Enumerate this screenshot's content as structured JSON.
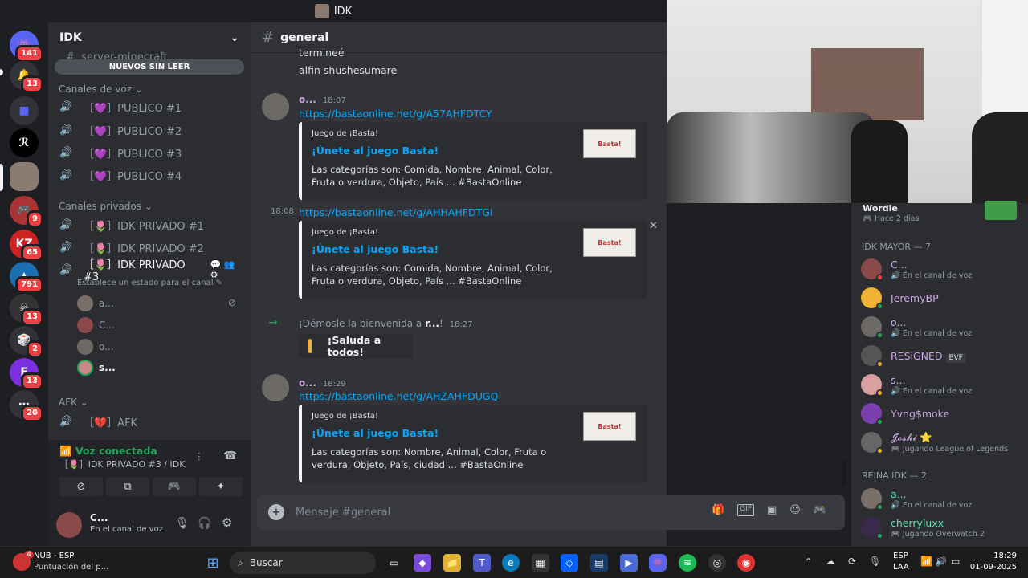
{
  "window": {
    "title": "IDK"
  },
  "rail": {
    "badges": [
      "141",
      "13",
      "9",
      "65",
      "791",
      "13",
      "2",
      "13",
      "20"
    ]
  },
  "server": {
    "name": "IDK"
  },
  "sidebar": {
    "faded_channel": "server-minecraft",
    "new_unread": "NUEVOS SIN LEER",
    "voice_category": "Canales de voz",
    "voice_channels": [
      "［💜］PUBLICO #1",
      "［💜］PUBLICO #2",
      "［💜］PUBLICO #3",
      "［💜］PUBLICO #4"
    ],
    "private_category": "Canales privados",
    "private_channels": [
      "［🌷］IDK PRIVADO #1",
      "［🌷］IDK PRIVADO #2",
      "［🌷］IDK PRIVADO #3"
    ],
    "status_hint": "Establece un estado para el canal",
    "voice_users": [
      "a...",
      "C...",
      "o...",
      "s..."
    ],
    "afk_category": "AFK",
    "afk_channel": "［💔］AFK"
  },
  "voice_panel": {
    "status": "Voz conectada",
    "channel": "［🌷］IDK PRIVADO #3 / IDK"
  },
  "user_panel": {
    "name": "C...",
    "status": "En el canal de voz"
  },
  "chat": {
    "channel": "general",
    "top_text_1": "termineé",
    "top_text_2": "alfin shushesumare",
    "msg1": {
      "author": "o...",
      "time": "18:07",
      "link": "https://bastaonline.net/g/A57AHFDTCY"
    },
    "embed_provider": "Juego de ¡Basta!",
    "embed_title": "¡Únete al juego Basta!",
    "embed1_desc": "Las categorías son: Comida, Nombre, Animal, Color, Fruta o verdura, Objeto, País ... #BastaOnline",
    "msg2": {
      "time": "18:08",
      "link": "https://bastaonline.net/g/AHHAHFDTGI"
    },
    "embed2_desc": "Las categorías son: Comida, Nombre, Animal, Color, Fruta o verdura, Objeto, País ... #BastaOnline",
    "welcome": {
      "prefix": "¡Démosle la bienvenida a ",
      "name": "r...",
      "suffix": "!",
      "time": "18:27",
      "sticker": "¡Saluda a todos!"
    },
    "msg3": {
      "author": "o...",
      "time": "18:29",
      "link": "https://bastaonline.net/g/AHZAHFDUGQ"
    },
    "embed3_desc": "Las categorías son: Nombre, Animal, Color, Fruta o verdura, Objeto, País, ciudad ... #BastaOnline",
    "thumb_text": "Basta!",
    "composer_placeholder": "Mensaje #general"
  },
  "members": {
    "wordle": {
      "name": "Wordle",
      "sub": "Hace 2 días"
    },
    "group1": "IDK MAYOR — 7",
    "list1": [
      {
        "name": "C...",
        "sub": "En el canal de voz",
        "color": "#c9a6e0"
      },
      {
        "name": "JeremyBP",
        "sub": "",
        "color": "#c9a6e0"
      },
      {
        "name": "o...",
        "sub": "En el canal de voz",
        "color": "#c9a6e0"
      },
      {
        "name": "RESiGNED",
        "sub": "",
        "color": "#c9a6e0",
        "tag": "BVF"
      },
      {
        "name": "s...",
        "sub": "En el canal de voz",
        "color": "#c9a6e0"
      },
      {
        "name": "Yvng$moke",
        "sub": "",
        "color": "#c9a6e0"
      },
      {
        "name": "𝓙𝓸𝓼𝓱𝓲",
        "sub": "Jugando League of Legends",
        "color": "#c9a6e0"
      }
    ],
    "group2": "REINA IDK — 2",
    "list2": [
      {
        "name": "a...",
        "sub": "En el canal de voz",
        "color": "#5ee0b0"
      },
      {
        "name": "cherryluxx",
        "sub": "Jugando Overwatch 2",
        "color": "#5ee0b0"
      }
    ]
  },
  "taskbar": {
    "notif_count": "4",
    "app_title": "NUB - ESP",
    "app_sub": "Puntuación del p...",
    "search": "Buscar",
    "lang": "ESP",
    "lang_sub": "LAA",
    "time": "18:29",
    "date": "01-09-2025"
  }
}
